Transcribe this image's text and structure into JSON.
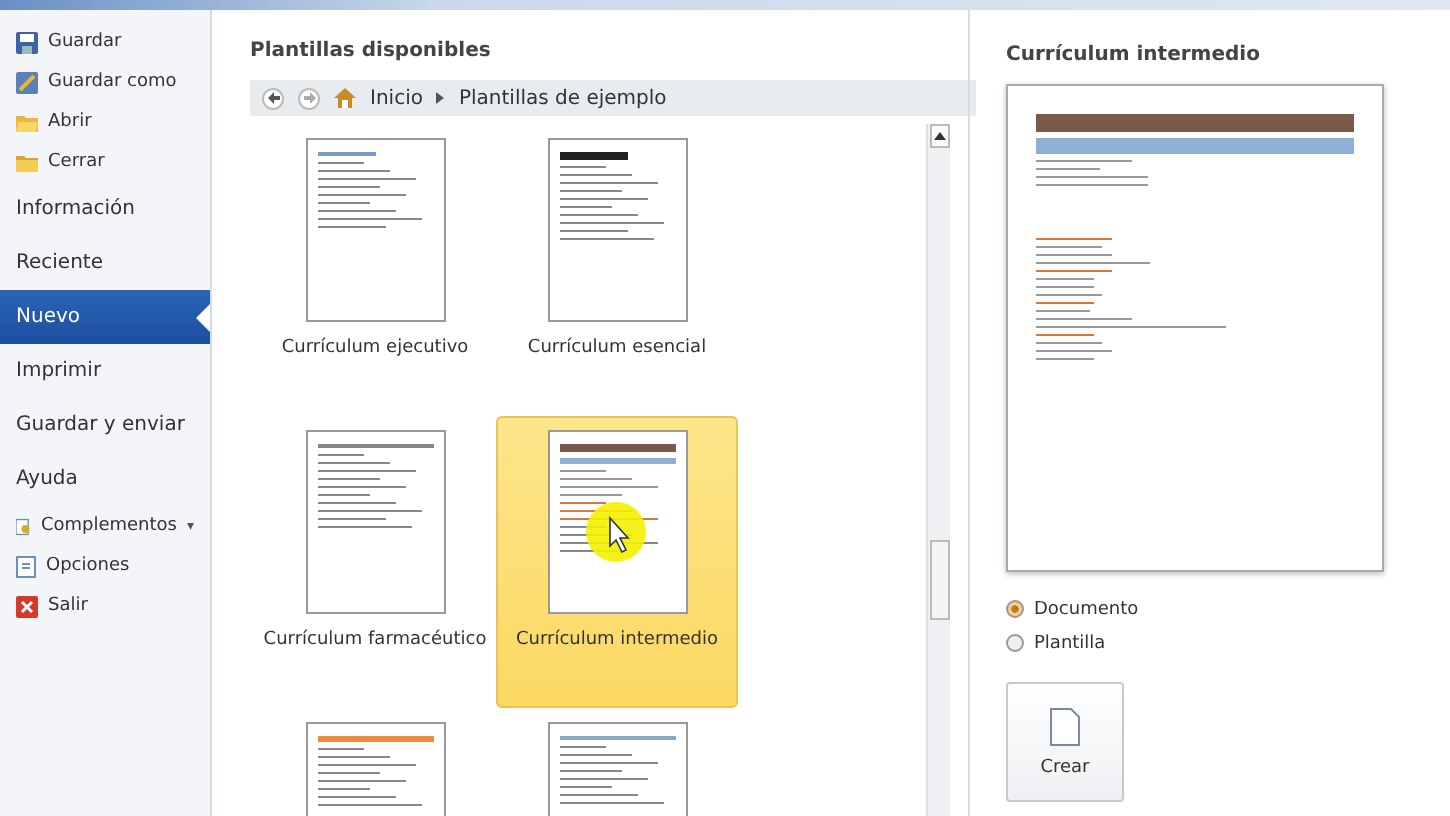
{
  "sidebar": {
    "items": [
      {
        "kind": "command",
        "label": "Guardar",
        "selected": false
      },
      {
        "kind": "command",
        "label": "Guardar como",
        "selected": false
      },
      {
        "kind": "command",
        "label": "Abrir",
        "selected": false
      },
      {
        "kind": "command",
        "label": "Cerrar",
        "selected": false
      },
      {
        "kind": "section",
        "label": "Información",
        "selected": false
      },
      {
        "kind": "section",
        "label": "Reciente",
        "selected": false
      },
      {
        "kind": "section",
        "label": "Nuevo",
        "selected": true
      },
      {
        "kind": "section",
        "label": "Imprimir",
        "selected": false
      },
      {
        "kind": "section",
        "label": "Guardar y enviar",
        "selected": false
      },
      {
        "kind": "section",
        "label": "Ayuda",
        "selected": false
      },
      {
        "kind": "command",
        "label": "Complementos",
        "dropdown": "▾",
        "selected": false
      },
      {
        "kind": "command",
        "label": "Opciones",
        "selected": false
      },
      {
        "kind": "command",
        "label": "Salir",
        "selected": false
      }
    ]
  },
  "templates": {
    "title": "Plantillas disponibles",
    "breadcrumb": [
      "Inicio",
      "Plantillas de ejemplo"
    ],
    "items": [
      {
        "title": "Currículum ejecutivo",
        "selected": false
      },
      {
        "title": "Currículum esencial",
        "selected": false
      },
      {
        "title": "Currículum farmacéutico",
        "selected": false
      },
      {
        "title": "Currículum intermedio",
        "selected": true
      },
      {
        "selected": false
      },
      {
        "selected": false
      }
    ]
  },
  "preview": {
    "title": "Currículum intermedio",
    "options": [
      {
        "label": "Documento",
        "selected": true
      },
      {
        "label": "Plantilla",
        "selected": false
      }
    ],
    "create_button": "Crear"
  }
}
